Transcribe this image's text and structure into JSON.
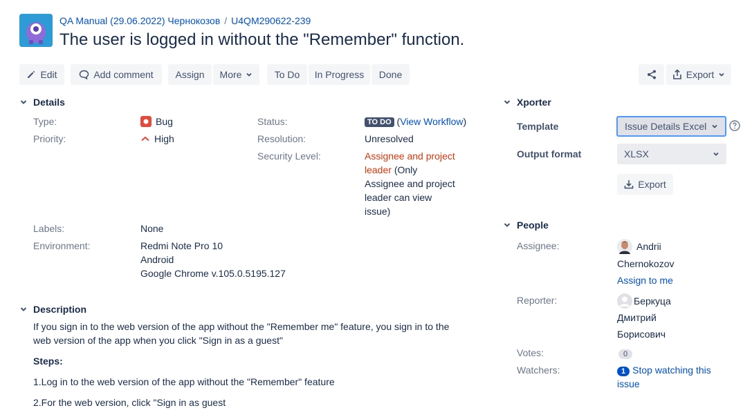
{
  "breadcrumb": {
    "project": "QA Manual (29.06.2022) Чернокозов",
    "issue_key": "U4QM290622-239"
  },
  "issue_title": "The user is logged in without the \"Remember\" function.",
  "toolbar": {
    "edit": "Edit",
    "add_comment": "Add comment",
    "assign": "Assign",
    "more": "More",
    "to_do": "To Do",
    "in_progress": "In Progress",
    "done": "Done",
    "export": "Export"
  },
  "details": {
    "heading": "Details",
    "type_label": "Type:",
    "type_value": "Bug",
    "priority_label": "Priority:",
    "priority_value": "High",
    "status_label": "Status:",
    "status_value": "TO DO",
    "view_workflow": "View Workflow",
    "resolution_label": "Resolution:",
    "resolution_value": "Unresolved",
    "security_label": "Security Level:",
    "security_line1": "Assignee and project",
    "security_line2": "leader",
    "security_line2b": "(Only",
    "security_line3": "Assignee and project",
    "security_line4": "leader can view",
    "security_line5": "issue)",
    "labels_label": "Labels:",
    "labels_value": "None",
    "environment_label": "Environment:",
    "environment_lines": [
      "Redmi Note Pro 10",
      "Android",
      "Google Chrome v.105.0.5195.127"
    ]
  },
  "description": {
    "heading": "Description",
    "line1": "If you sign in to the web version of the app without the \"Remember me\" feature, you sign in to the",
    "line2": "web version of the app when you click \"Sign in as a guest\"",
    "steps": "Steps:",
    "step1": "1.Log in to the web version of the app without the \"Remember\" feature",
    "step2": "2.For the web version, click \"Sign in as guest"
  },
  "xporter": {
    "heading": "Xporter",
    "template_label": "Template",
    "template_value": "Issue Details Excel",
    "format_label": "Output format",
    "format_value": "XLSX",
    "export_button": "Export"
  },
  "people": {
    "heading": "People",
    "assignee_label": "Assignee:",
    "assignee_first": "Andrii",
    "assignee_last": "Chernokozov",
    "assign_to_me": "Assign to me",
    "reporter_label": "Reporter:",
    "reporter_line1": "Беркуца",
    "reporter_line2": "Дмитрий",
    "reporter_line3": "Борисович",
    "votes_label": "Votes:",
    "votes_value": "0",
    "watchers_label": "Watchers:",
    "watchers_value": "1",
    "watch_line1": "Stop watching this",
    "watch_line2": "issue"
  },
  "colors": {
    "link": "#0052cc",
    "bug_red": "#e5493a",
    "lozenge": "#42526e",
    "focus": "#4c9aff"
  }
}
